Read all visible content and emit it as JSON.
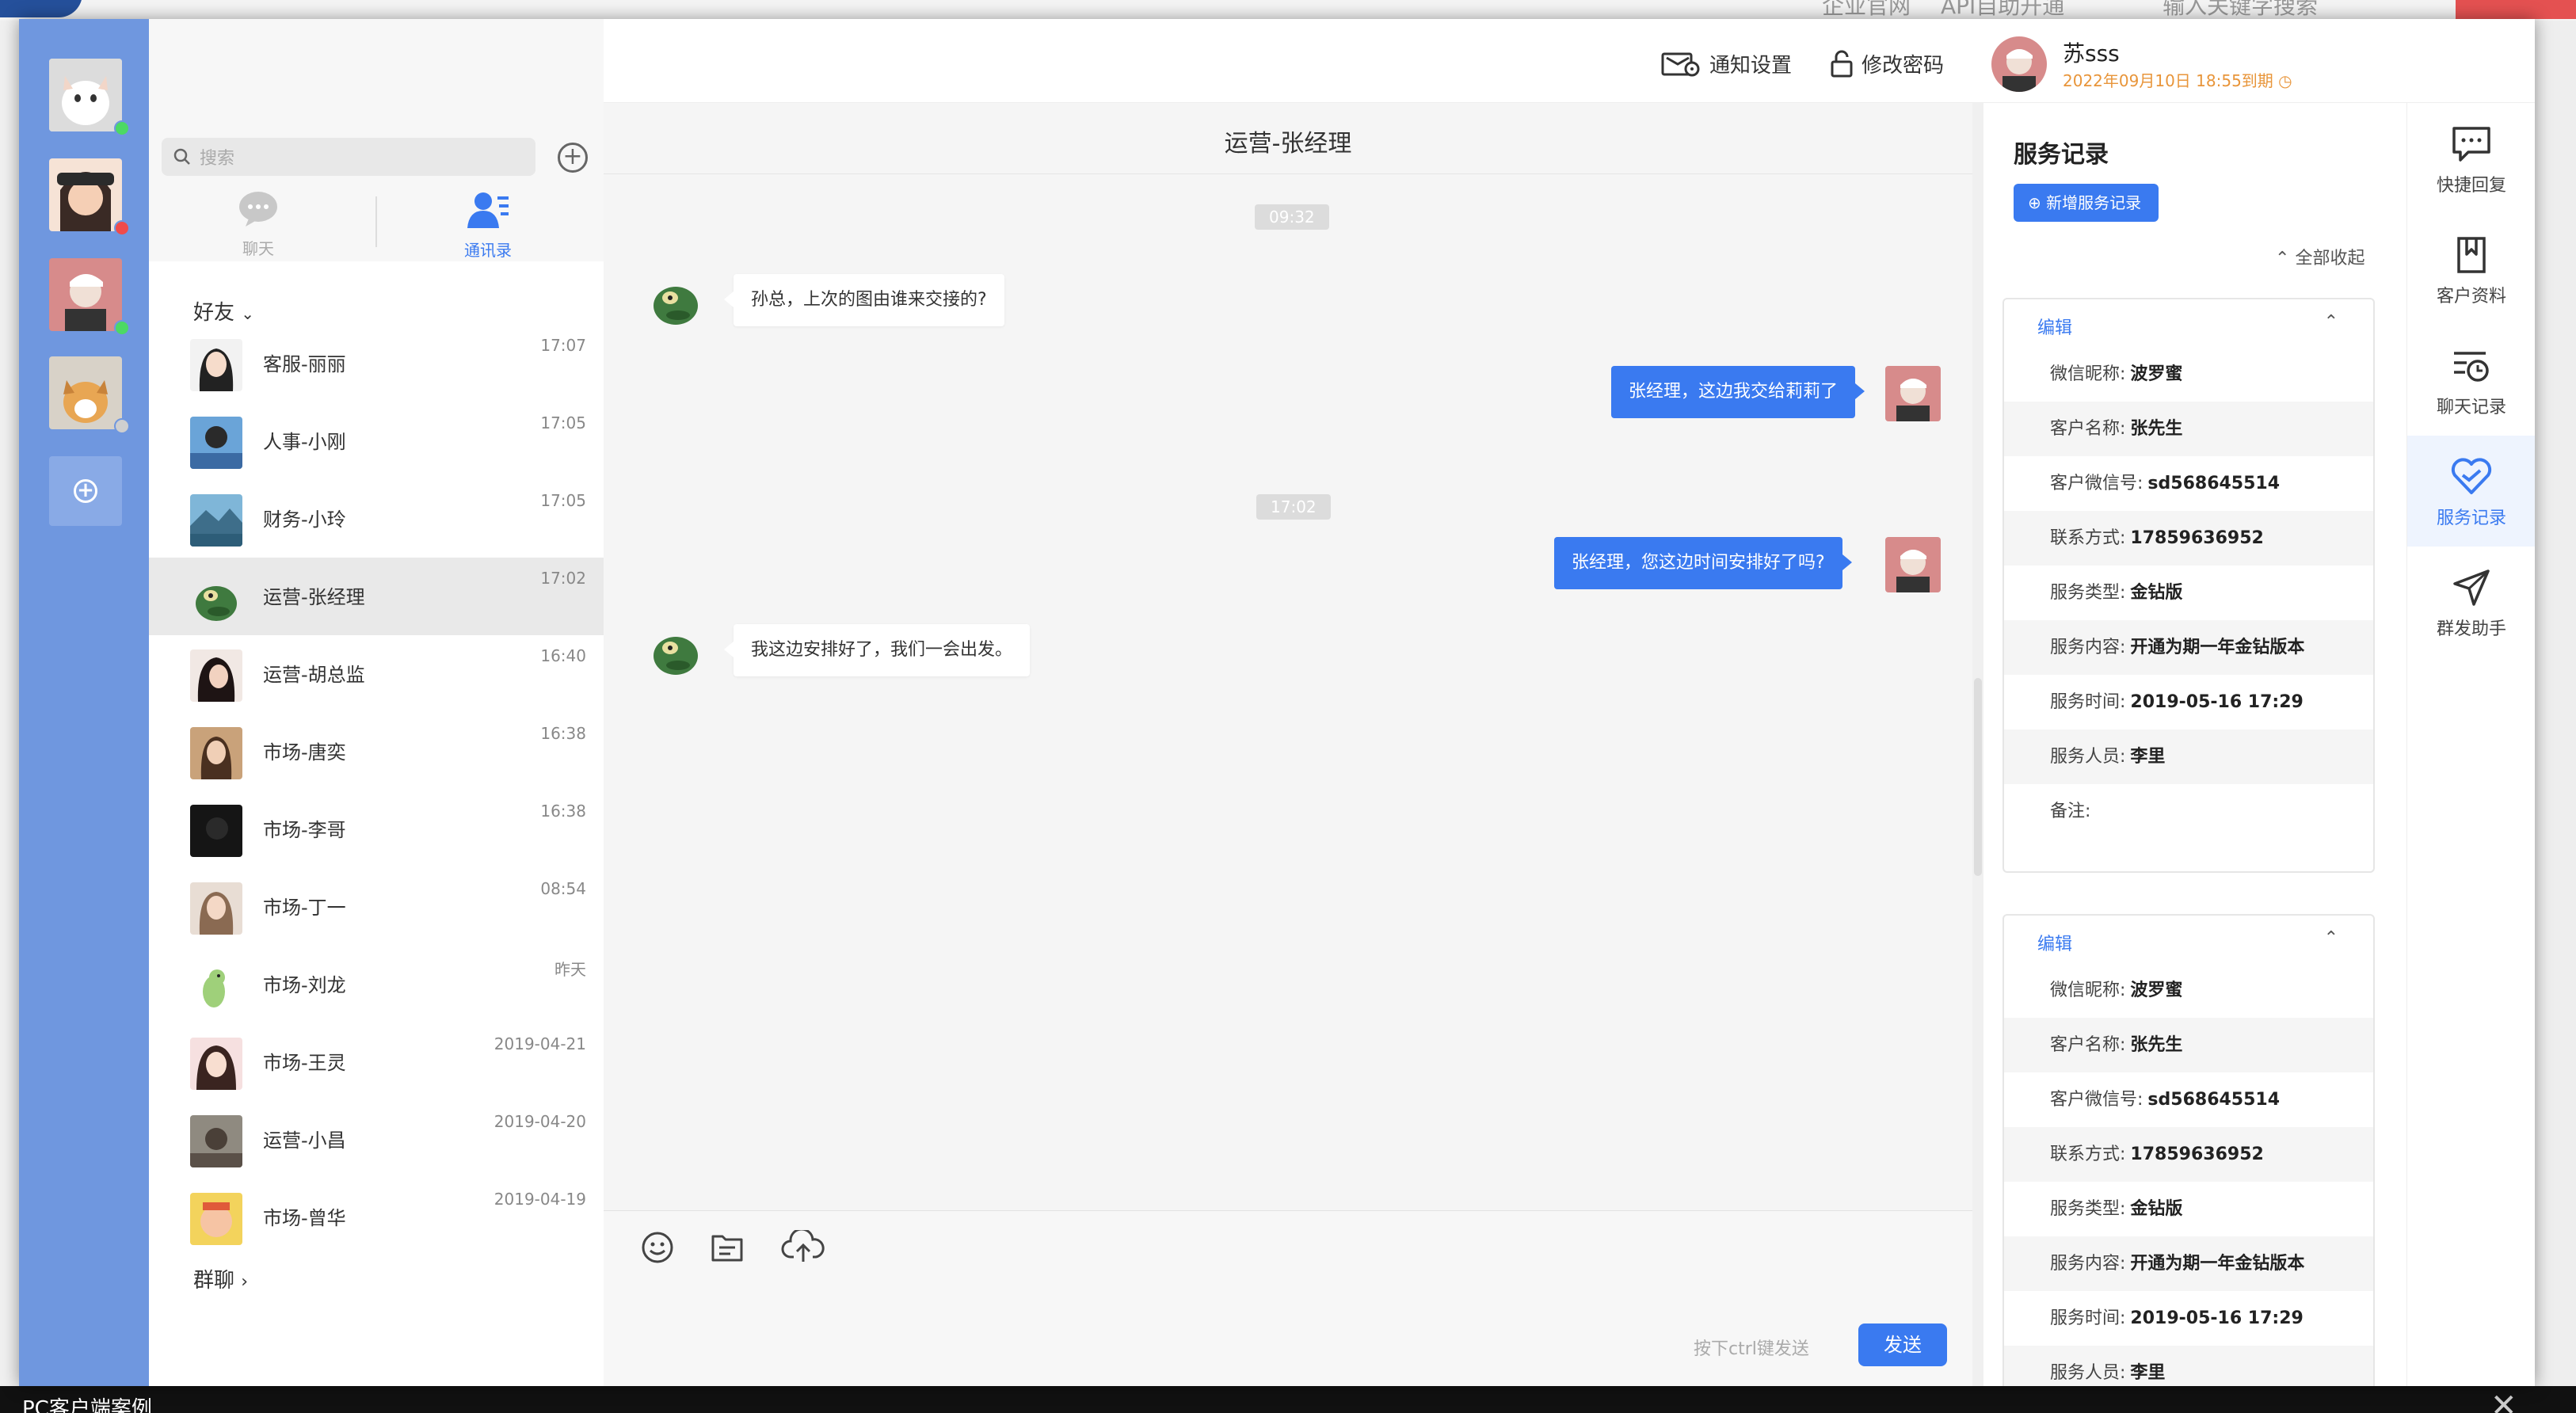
{
  "background": {
    "top_texts": [
      "企业官网",
      "API自助开通",
      "输入关键字搜索"
    ],
    "caption": "PC客户端案例"
  },
  "rail": {
    "add_label": "+"
  },
  "contacts": {
    "search_placeholder": "搜索",
    "tabs": [
      {
        "label": "聊天",
        "active": false
      },
      {
        "label": "通讯录",
        "active": true
      }
    ],
    "group_friends": "好友",
    "group_chats": "群聊",
    "items": [
      {
        "name": "客服-丽丽",
        "time": "17:07"
      },
      {
        "name": "人事-小刚",
        "time": "17:05"
      },
      {
        "name": "财务-小玲",
        "time": "17:05"
      },
      {
        "name": "运营-张经理",
        "time": "17:02",
        "selected": true
      },
      {
        "name": "运营-胡总监",
        "time": "16:40"
      },
      {
        "name": "市场-唐奕",
        "time": "16:38"
      },
      {
        "name": "市场-李哥",
        "time": "16:38"
      },
      {
        "name": "市场-丁一",
        "time": "08:54"
      },
      {
        "name": "市场-刘龙",
        "time": "昨天"
      },
      {
        "name": "市场-王灵",
        "time": "2019-04-21"
      },
      {
        "name": "运营-小昌",
        "time": "2019-04-20"
      },
      {
        "name": "市场-曾华",
        "time": "2019-04-19"
      }
    ]
  },
  "topbar": {
    "notify_label": "通知设置",
    "password_label": "修改密码",
    "user_name": "苏sss",
    "user_expiry": "2022年09月10日 18:55到期"
  },
  "chat": {
    "title": "运营-张经理",
    "timestamps": [
      "09:32",
      "17:02"
    ],
    "messages": [
      {
        "dir": "in",
        "text": "孙总，上次的图由谁来交接的?"
      },
      {
        "dir": "out",
        "text": "张经理，这边我交给莉莉了"
      },
      {
        "dir": "out",
        "text": "张经理，您这边时间安排好了吗?"
      },
      {
        "dir": "in",
        "text": "我这边安排好了，我们一会出发。"
      }
    ],
    "hint": "按下ctrl键发送",
    "send_label": "发送"
  },
  "service": {
    "title": "服务记录",
    "new_label": "新增服务记录",
    "collapse_label": "全部收起",
    "edit_label": "编辑",
    "cards": [
      {
        "rows": [
          {
            "label": "微信昵称:",
            "value": "波罗蜜"
          },
          {
            "label": "客户名称:",
            "value": "张先生"
          },
          {
            "label": "客户微信号:",
            "value": "sd568645514"
          },
          {
            "label": "联系方式:",
            "value": "17859636952"
          },
          {
            "label": "服务类型:",
            "value": "金钻版"
          },
          {
            "label": "服务内容:",
            "value": "开通为期一年金钻版本"
          },
          {
            "label": "服务时间:",
            "value": "2019-05-16   17:29"
          },
          {
            "label": "服务人员:",
            "value": "李里"
          },
          {
            "label": "备注:",
            "value": ""
          }
        ]
      },
      {
        "rows": [
          {
            "label": "微信昵称:",
            "value": "波罗蜜"
          },
          {
            "label": "客户名称:",
            "value": "张先生"
          },
          {
            "label": "客户微信号:",
            "value": "sd568645514"
          },
          {
            "label": "联系方式:",
            "value": "17859636952"
          },
          {
            "label": "服务类型:",
            "value": "金钻版"
          },
          {
            "label": "服务内容:",
            "value": "开通为期一年金钻版本"
          },
          {
            "label": "服务时间:",
            "value": "2019-05-16   17:29"
          },
          {
            "label": "服务人员:",
            "value": "李里"
          }
        ]
      }
    ]
  },
  "sidebar": {
    "items": [
      {
        "label": "快捷回复",
        "icon": "quick-reply-icon"
      },
      {
        "label": "客户资料",
        "icon": "customer-profile-icon"
      },
      {
        "label": "聊天记录",
        "icon": "chat-history-icon"
      },
      {
        "label": "服务记录",
        "icon": "service-record-icon",
        "active": true
      },
      {
        "label": "群发助手",
        "icon": "broadcast-icon"
      }
    ]
  },
  "colors": {
    "accent": "#3a7af0",
    "rail": "#6f97df",
    "expiry": "#e8953a"
  }
}
